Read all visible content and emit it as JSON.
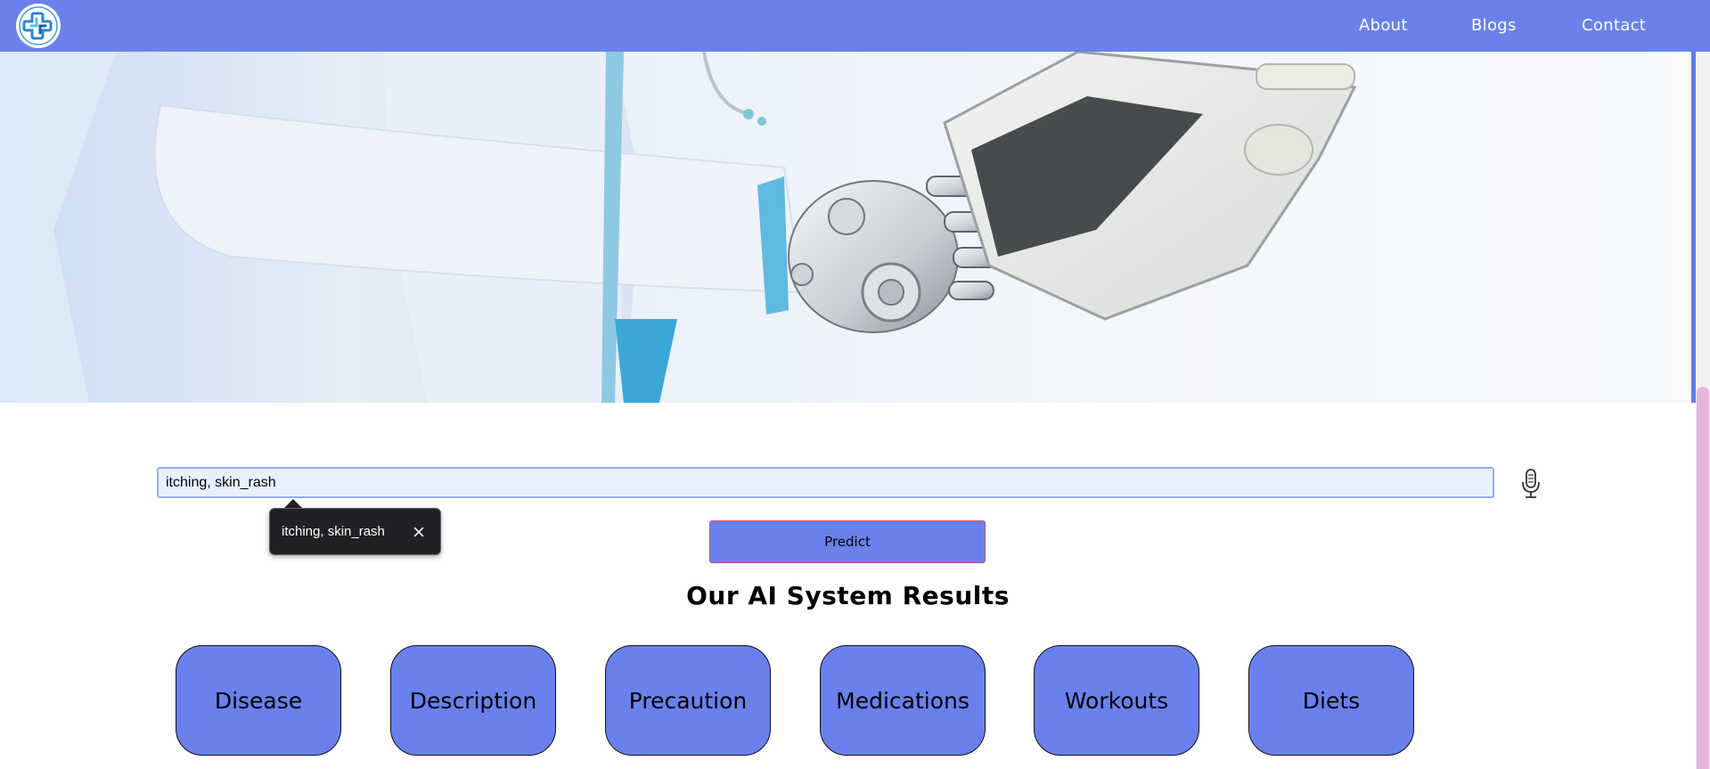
{
  "navbar": {
    "logo_icon": "medical-cross-logo",
    "links": [
      "About",
      "Blogs",
      "Contact"
    ]
  },
  "hero": {
    "image": "robot-hand-holding-tablet"
  },
  "search": {
    "value": "itching, skin_rash",
    "mic_icon": "microphone-icon"
  },
  "autofill": {
    "suggestion": "itching, skin_rash",
    "close_icon": "close-icon"
  },
  "predict": {
    "label": "Predict"
  },
  "results": {
    "title": "Our AI System Results",
    "buttons": [
      "Disease",
      "Description",
      "Precaution",
      "Medications",
      "Workouts",
      "Diets"
    ]
  },
  "colors": {
    "accent": "#6a80ec",
    "scrollbar_thumb": "#e4b5dc",
    "predict_border": "#d6476b",
    "popup_bg": "#202124"
  }
}
